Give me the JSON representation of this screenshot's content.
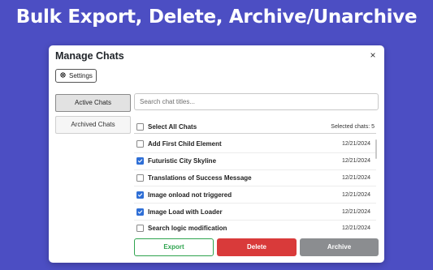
{
  "headline": "Bulk Export, Delete, Archive/Unarchive",
  "modal": {
    "title": "Manage Chats",
    "close_symbol": "×",
    "settings_label": "Settings",
    "settings_icon": "gear-icon"
  },
  "tabs": [
    {
      "label": "Active Chats",
      "active": true
    },
    {
      "label": "Archived Chats",
      "active": false
    }
  ],
  "search": {
    "placeholder": "Search chat titles...",
    "value": ""
  },
  "list": {
    "select_all_label": "Select All Chats",
    "select_all_checked": false,
    "selected_count_text": "Selected chats: 5",
    "rows": [
      {
        "title": "Add First Child Element",
        "date": "12/21/2024",
        "checked": false
      },
      {
        "title": "Futuristic City Skyline",
        "date": "12/21/2024",
        "checked": true
      },
      {
        "title": "Translations of Success Message",
        "date": "12/21/2024",
        "checked": false
      },
      {
        "title": "Image onload not triggered",
        "date": "12/21/2024",
        "checked": true
      },
      {
        "title": "Image Load with Loader",
        "date": "12/21/2024",
        "checked": true
      },
      {
        "title": "Search logic modification",
        "date": "12/21/2024",
        "checked": false
      }
    ]
  },
  "actions": {
    "export_label": "Export",
    "delete_label": "Delete",
    "archive_label": "Archive"
  },
  "colors": {
    "background": "#4c4ec3",
    "checkbox_checked": "#2f6fd6",
    "export": "#2fa44f",
    "delete": "#d93a3a",
    "archive": "#8b8d90"
  }
}
